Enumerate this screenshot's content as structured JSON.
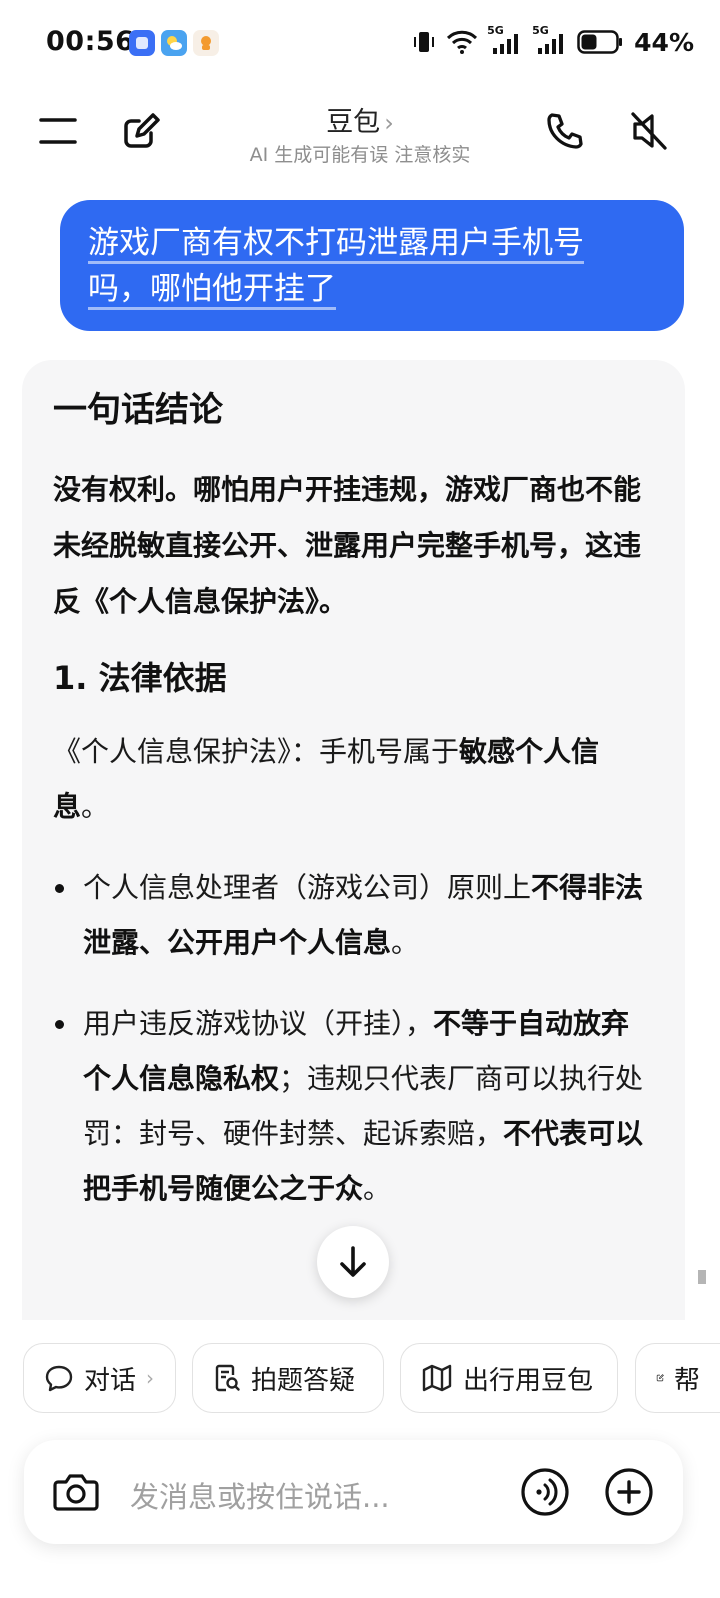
{
  "status_bar": {
    "time": "00:56",
    "apps": [
      {
        "icon": "app-icon-blue",
        "color": "#3b6ff5"
      },
      {
        "icon": "weather-icon",
        "color": "#4aa3f0"
      },
      {
        "icon": "taobao-icon",
        "color": "#f7efe6"
      }
    ],
    "net1": "5G",
    "net2": "5G",
    "battery": "44%"
  },
  "header": {
    "title": "豆包",
    "title_chevron": "›",
    "subtitle": "AI 生成可能有误 注意核实"
  },
  "user_message": {
    "line1": "游戏厂商有权不打码泄露用户手机号",
    "line2": "吗，哪怕他开挂了"
  },
  "answer": {
    "heading": "一句话结论",
    "conclusion": "没有权利。哪怕用户开挂违规，游戏厂商也不能未经脱敏直接公开、泄露用户完整手机号，这违反《个人信息保护法》。",
    "section1_title": "1. 法律依据",
    "p1_normal": "《个人信息保护法》：手机号属于",
    "p1_bold": "敏感个人信息",
    "p1_end": "。",
    "b1_normal": "个人信息处理者（游戏公司）原则上",
    "b1_bold": "不得非法泄露、公开用户个人信息",
    "b1_end": "。",
    "b2_normal1": "用户违反游戏协议（开挂），",
    "b2_bold1": "不等于自动放弃个人信息隐私权",
    "b2_normal2": "；违规只代表厂商可以执行处罚：封号、硬件封禁、起诉索赔，",
    "b2_bold2": "不代表可以把手机号随便公之于众",
    "b2_end": "。"
  },
  "chips": [
    {
      "label": "对话",
      "icon": "chat-bubble-icon",
      "chevron": "›"
    },
    {
      "label": "拍题答疑",
      "icon": "search-doc-icon"
    },
    {
      "label": "出行用豆包",
      "icon": "map-icon"
    },
    {
      "label": "帮",
      "icon": "edit-icon"
    }
  ],
  "input": {
    "placeholder": "发消息或按住说话..."
  },
  "colors": {
    "bubble": "#2f6af2",
    "card": "#f6f6f7"
  }
}
